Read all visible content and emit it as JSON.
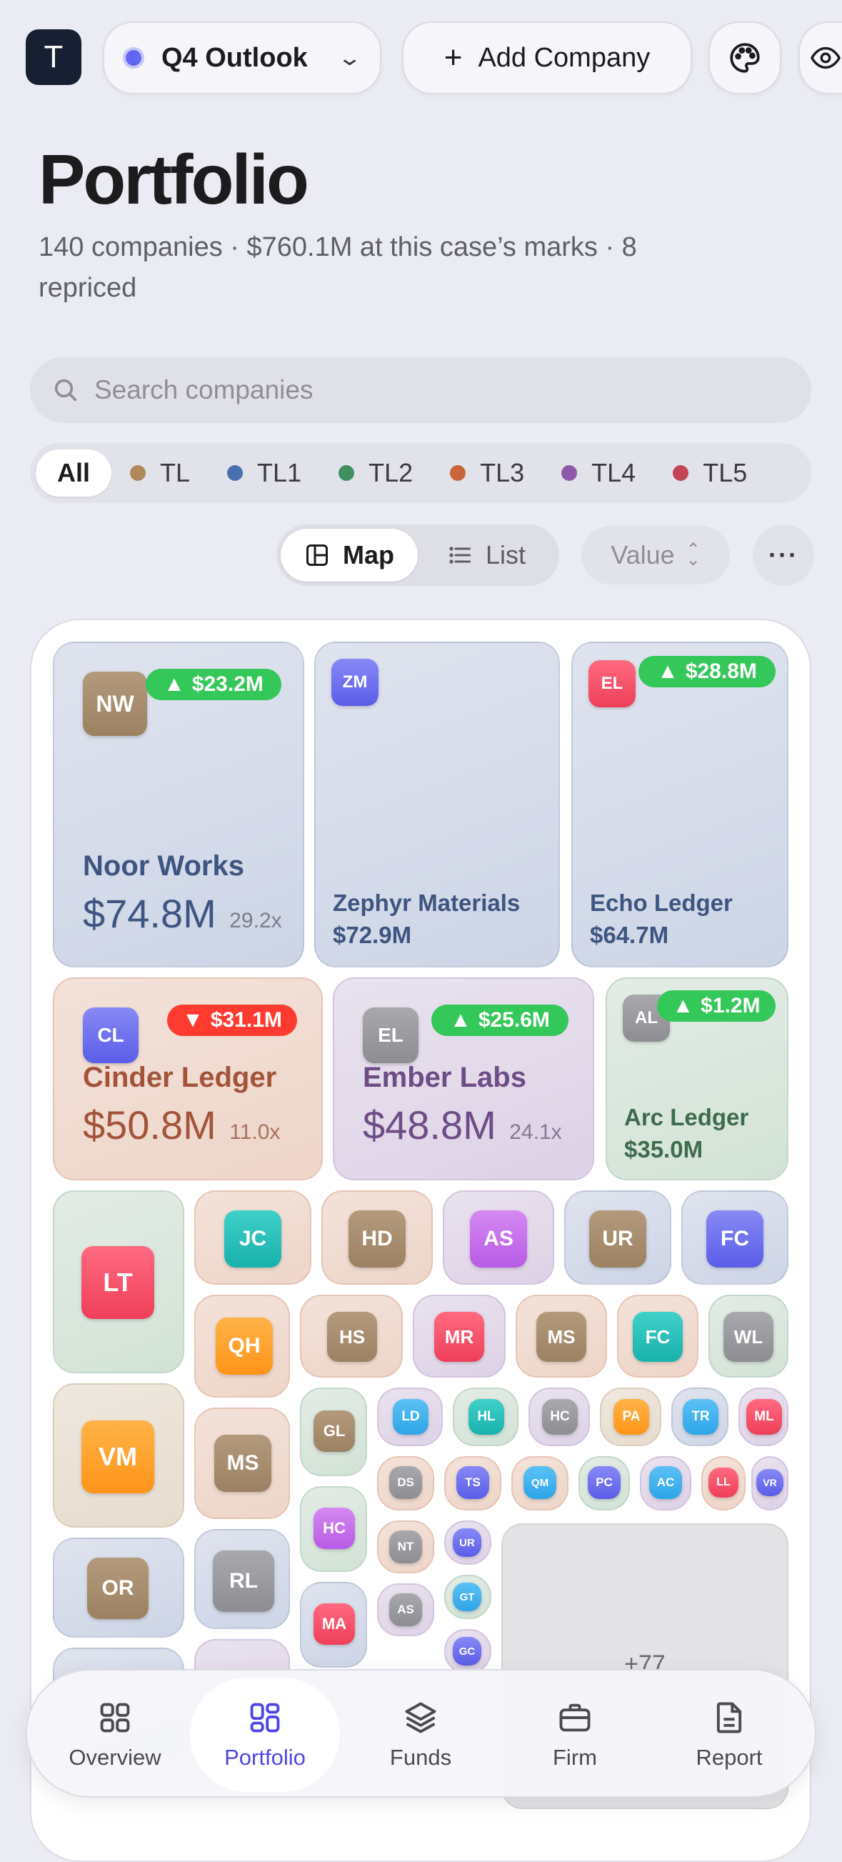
{
  "topbar": {
    "avatar_letter": "T",
    "scenario": "Q4 Outlook",
    "add_company": "Add Company"
  },
  "header": {
    "title": "Portfolio",
    "subtitle": "140 companies · $760.1M at this case’s marks · 8 repriced"
  },
  "search": {
    "placeholder": "Search companies"
  },
  "filters": [
    {
      "label": "All",
      "color": ""
    },
    {
      "label": "TL",
      "color": "#b0895a"
    },
    {
      "label": "TL1",
      "color": "#4a70b0"
    },
    {
      "label": "TL2",
      "color": "#3f8f60"
    },
    {
      "label": "TL3",
      "color": "#c8653a"
    },
    {
      "label": "TL4",
      "color": "#8e5aa8"
    },
    {
      "label": "TL5",
      "color": "#c24656"
    }
  ],
  "view": {
    "map": "Map",
    "list": "List",
    "sort": "Value",
    "more": "···"
  },
  "tiles_large": [
    {
      "initials": "NW",
      "name": "Noor Works",
      "value": "$74.8M",
      "multiple": "29.2x",
      "delta": "$23.2M"
    },
    {
      "initials": "ZM",
      "name": "Zephyr Materials",
      "value": "$72.9M"
    },
    {
      "initials": "EL",
      "name": "Echo Ledger",
      "value": "$64.7M",
      "delta": "$28.8M"
    },
    {
      "initials": "CL",
      "name": "Cinder Ledger",
      "value": "$50.8M",
      "multiple": "11.0x",
      "delta": "$31.1M"
    },
    {
      "initials": "EL",
      "name": "Ember Labs",
      "value": "$48.8M",
      "multiple": "24.1x",
      "delta": "$25.6M"
    },
    {
      "initials": "AL",
      "name": "Arc Ledger",
      "value": "$35.0M",
      "delta": "$1.2M"
    }
  ],
  "overflow_label": "+77",
  "tabs": {
    "overview": "Overview",
    "portfolio": "Portfolio",
    "funds": "Funds",
    "firm": "Firm",
    "report": "Report"
  },
  "colors": {
    "accent": "#4f46e5",
    "positive": "#34c759",
    "negative": "#ff3b30"
  }
}
